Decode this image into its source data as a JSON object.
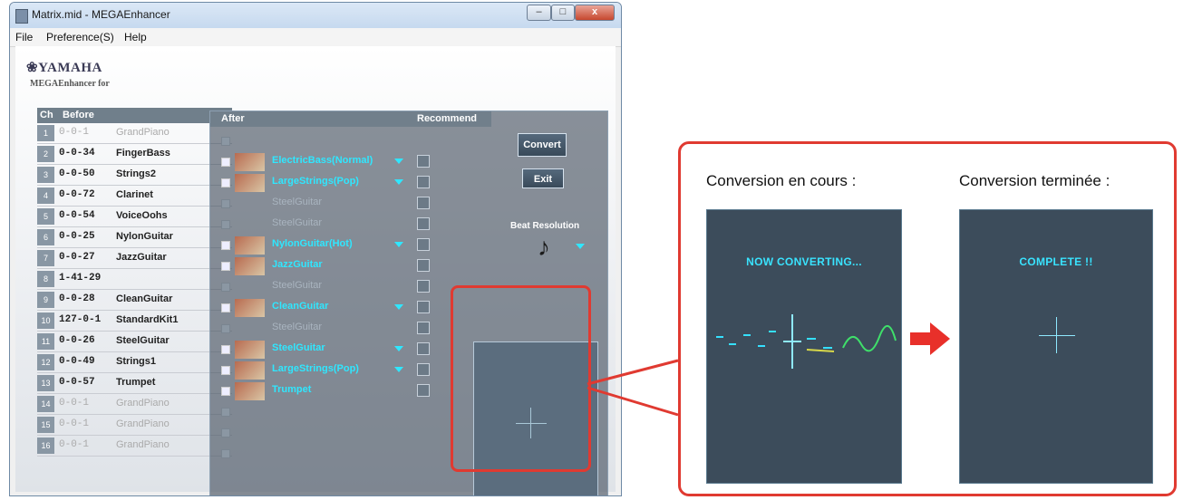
{
  "window": {
    "title": "Matrix.mid - MEGAEnhancer",
    "controls": {
      "minimize": "–",
      "maximize": "□",
      "close": "x"
    }
  },
  "menu": [
    "File",
    "Preference(S)",
    "Help"
  ],
  "brand": {
    "logo": "❀YAMAHA",
    "subtitle": "MEGAEnhancer for"
  },
  "before": {
    "headers": {
      "ch": "Ch",
      "before": "Before"
    },
    "rows": [
      {
        "ch": "1",
        "pc": "0-0-1",
        "name": "GrandPiano",
        "active": false
      },
      {
        "ch": "2",
        "pc": "0-0-34",
        "name": "FingerBass",
        "active": true
      },
      {
        "ch": "3",
        "pc": "0-0-50",
        "name": "Strings2",
        "active": true
      },
      {
        "ch": "4",
        "pc": "0-0-72",
        "name": "Clarinet",
        "active": true
      },
      {
        "ch": "5",
        "pc": "0-0-54",
        "name": "VoiceOohs",
        "active": true
      },
      {
        "ch": "6",
        "pc": "0-0-25",
        "name": "NylonGuitar",
        "active": true
      },
      {
        "ch": "7",
        "pc": "0-0-27",
        "name": "JazzGuitar",
        "active": true
      },
      {
        "ch": "8",
        "pc": "1-41-29",
        "name": "",
        "active": true
      },
      {
        "ch": "9",
        "pc": "0-0-28",
        "name": "CleanGuitar",
        "active": true
      },
      {
        "ch": "10",
        "pc": "127-0-1",
        "name": "StandardKit1",
        "active": true
      },
      {
        "ch": "11",
        "pc": "0-0-26",
        "name": "SteelGuitar",
        "active": true
      },
      {
        "ch": "12",
        "pc": "0-0-49",
        "name": "Strings1",
        "active": true
      },
      {
        "ch": "13",
        "pc": "0-0-57",
        "name": "Trumpet",
        "active": true
      },
      {
        "ch": "14",
        "pc": "0-0-1",
        "name": "GrandPiano",
        "active": false
      },
      {
        "ch": "15",
        "pc": "0-0-1",
        "name": "GrandPiano",
        "active": false
      },
      {
        "ch": "16",
        "pc": "0-0-1",
        "name": "GrandPiano",
        "active": false
      }
    ]
  },
  "after": {
    "headers": {
      "after": "After",
      "recommend": "Recommend"
    },
    "rows": [
      {
        "name": "",
        "enabled": false,
        "thumb": false,
        "dropdown": false,
        "recommend": false
      },
      {
        "name": "ElectricBass(Normal)",
        "enabled": true,
        "thumb": true,
        "dropdown": true,
        "recommend": true
      },
      {
        "name": "LargeStrings(Pop)",
        "enabled": true,
        "thumb": true,
        "dropdown": true,
        "recommend": true
      },
      {
        "name": "SteelGuitar",
        "enabled": false,
        "thumb": false,
        "dropdown": false,
        "recommend": true
      },
      {
        "name": "SteelGuitar",
        "enabled": false,
        "thumb": false,
        "dropdown": false,
        "recommend": true
      },
      {
        "name": "NylonGuitar(Hot)",
        "enabled": true,
        "thumb": true,
        "dropdown": true,
        "recommend": true
      },
      {
        "name": "JazzGuitar",
        "enabled": true,
        "thumb": true,
        "dropdown": false,
        "recommend": true
      },
      {
        "name": "SteelGuitar",
        "enabled": false,
        "thumb": false,
        "dropdown": false,
        "recommend": true
      },
      {
        "name": "CleanGuitar",
        "enabled": true,
        "thumb": true,
        "dropdown": true,
        "recommend": true
      },
      {
        "name": "SteelGuitar",
        "enabled": false,
        "thumb": false,
        "dropdown": false,
        "recommend": true
      },
      {
        "name": "SteelGuitar",
        "enabled": true,
        "thumb": true,
        "dropdown": true,
        "recommend": true
      },
      {
        "name": "LargeStrings(Pop)",
        "enabled": true,
        "thumb": true,
        "dropdown": true,
        "recommend": true
      },
      {
        "name": "Trumpet",
        "enabled": true,
        "thumb": true,
        "dropdown": false,
        "recommend": true
      },
      {
        "name": "",
        "enabled": false,
        "thumb": false,
        "dropdown": false,
        "recommend": false
      },
      {
        "name": "",
        "enabled": false,
        "thumb": false,
        "dropdown": false,
        "recommend": false
      },
      {
        "name": "",
        "enabled": false,
        "thumb": false,
        "dropdown": false,
        "recommend": false
      }
    ]
  },
  "side": {
    "convert": "Convert",
    "exit": "Exit",
    "beat_label": "Beat Resolution",
    "beat_note": "♪"
  },
  "callout": {
    "left_caption": "Conversion en cours :",
    "right_caption": "Conversion terminée :",
    "left_screen": "NOW CONVERTING...",
    "right_screen": "COMPLETE !!"
  },
  "colors": {
    "accent_cyan": "#2fe7ff",
    "callout_red": "#e03a31"
  }
}
